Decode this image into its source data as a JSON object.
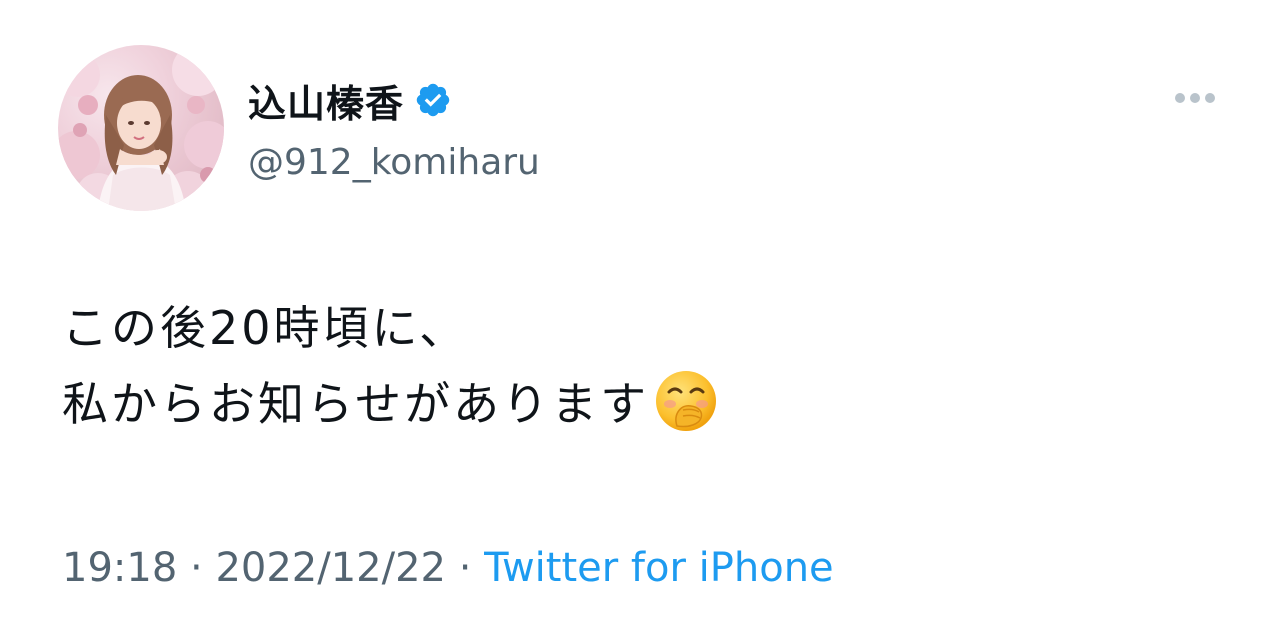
{
  "tweet": {
    "display_name": "込山榛香",
    "handle": "@912_komiharu",
    "verified": true,
    "text_lines": [
      "この後20時頃に、",
      "私からお知らせがあります"
    ],
    "emoji": "hand-over-mouth-emoji",
    "time": "19:18",
    "separator": " · ",
    "date": "2022/12/22",
    "source": "Twitter for iPhone"
  },
  "colors": {
    "accent": "#1d9bf0",
    "secondary_text": "#536471",
    "primary_text": "#0f1419"
  }
}
